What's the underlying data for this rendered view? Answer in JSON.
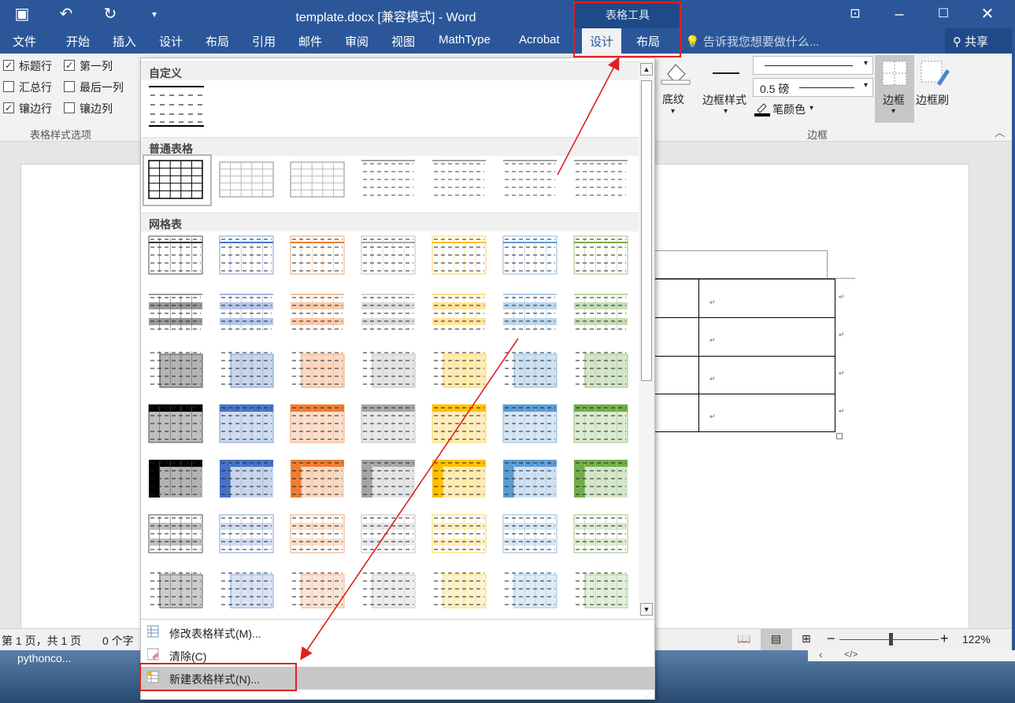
{
  "title": "template.docx [兼容模式] - Word",
  "context_header": "表格工具",
  "tabs": [
    "文件",
    "开始",
    "插入",
    "设计",
    "布局",
    "引用",
    "邮件",
    "审阅",
    "视图",
    "MathType",
    "Acrobat",
    "设计",
    "布局"
  ],
  "tell_me": "告诉我您想要做什么...",
  "share": "共享",
  "options": {
    "items": [
      {
        "label": "标题行",
        "checked": true
      },
      {
        "label": "第一列",
        "checked": true
      },
      {
        "label": "汇总行",
        "checked": false
      },
      {
        "label": "最后一列",
        "checked": false
      },
      {
        "label": "镶边行",
        "checked": true
      },
      {
        "label": "镶边列",
        "checked": false
      }
    ],
    "group": "表格样式选项"
  },
  "ribbon": {
    "shading": "底纹",
    "border_styles": "边框样式",
    "weight": "0.5 磅",
    "pen_color": "笔颜色",
    "borders": "边框",
    "border_painter": "边框刷",
    "group_borders": "边框"
  },
  "gallery": {
    "sections": [
      "自定义",
      "普通表格",
      "网格表"
    ],
    "palette": [
      "#000000",
      "#4472c4",
      "#ed7d31",
      "#a5a5a5",
      "#ffc000",
      "#5b9bd5",
      "#70ad47"
    ],
    "menu": [
      "修改表格样式(M)...",
      "清除(C)",
      "新建表格样式(N)..."
    ]
  },
  "status": {
    "page": "第 1 页，共 1 页",
    "words": "0 个字",
    "zoom": "122%"
  },
  "taskbar": "pythonco...",
  "returns_glyph": "↵"
}
